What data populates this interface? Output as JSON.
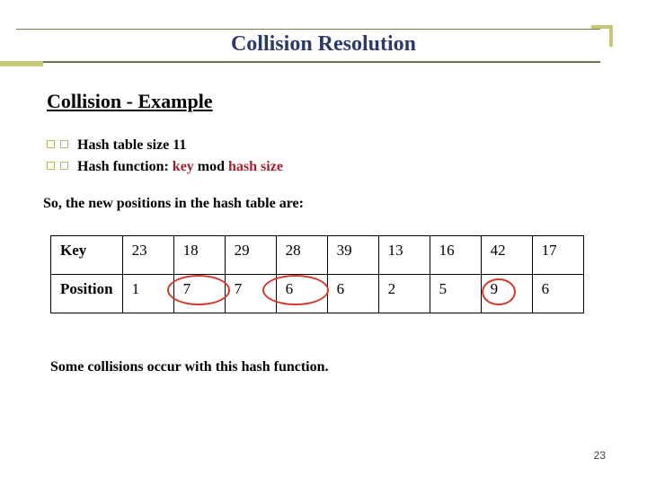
{
  "title": "Collision Resolution",
  "subheading": "Collision - Example",
  "bullets": [
    {
      "text": " Hash table size  11"
    },
    {
      "prefix": " Hash function: ",
      "accent1": "key",
      "mid": " mod ",
      "accent2": "hash size"
    }
  ],
  "intro_line": "So, the new positions in the hash table are:",
  "table": {
    "rows": [
      {
        "header": "Key",
        "cells": [
          "23",
          "18",
          "29",
          "28",
          "39",
          "13",
          "16",
          "42",
          "17"
        ]
      },
      {
        "header": "Position",
        "cells": [
          "1",
          "7",
          "7",
          "6",
          "6",
          "2",
          "5",
          "9",
          "6"
        ]
      }
    ]
  },
  "conclusion_line": "Some collisions occur with this hash function.",
  "page_number": "23",
  "chart_data": {
    "type": "table",
    "title": "Hash positions for keys (key mod 11)",
    "columns": [
      "Key",
      "Position"
    ],
    "keys": [
      23,
      18,
      29,
      28,
      39,
      13,
      16,
      42,
      17
    ],
    "positions": [
      1,
      7,
      7,
      6,
      6,
      2,
      5,
      9,
      6
    ],
    "hash_table_size": 11,
    "hash_function": "key mod hash_size",
    "collision_groups": [
      [
        18,
        29
      ],
      [
        28,
        39,
        17
      ]
    ]
  }
}
